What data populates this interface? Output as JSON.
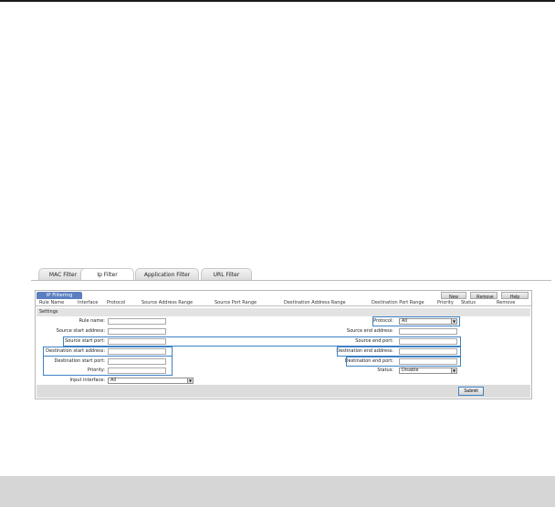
{
  "tabs": [
    {
      "label": "MAC Filter",
      "active": false
    },
    {
      "label": "Ip Filter",
      "active": true
    },
    {
      "label": "Application Filter",
      "active": false
    },
    {
      "label": "URL Filter",
      "active": false
    }
  ],
  "panel": {
    "title": "IP Filtering",
    "buttons": {
      "new": "New",
      "remove": "Remove",
      "help": "Help"
    },
    "columns": [
      "Rule Name",
      "Interface",
      "Protocol",
      "Source Address Range",
      "Source Port Range",
      "Destination Address Range",
      "Destination Port Range",
      "Priority",
      "Status",
      "Remove"
    ],
    "settings_title": "Settings"
  },
  "form": {
    "rule_name": {
      "label": "Rule name:",
      "value": ""
    },
    "source_start_address": {
      "label": "Source start address:",
      "value": ""
    },
    "source_start_port": {
      "label": "Source start port:",
      "value": ""
    },
    "destination_start_address": {
      "label": "Destination start address:",
      "value": ""
    },
    "destination_start_port": {
      "label": "Destination start port:",
      "value": ""
    },
    "priority": {
      "label": "Priority:",
      "value": ""
    },
    "input_interface": {
      "label": "Input interface:",
      "value": "All"
    },
    "protocol": {
      "label": "Protocol:",
      "value": "All"
    },
    "source_end_address": {
      "label": "Source end address:",
      "value": ""
    },
    "source_end_port": {
      "label": "Source end port:",
      "value": ""
    },
    "destination_end_address": {
      "label": "Destination end address:",
      "value": ""
    },
    "destination_end_port": {
      "label": "Destination end port:",
      "value": ""
    },
    "status": {
      "label": "Status:",
      "value": "Disable"
    }
  },
  "submit_label": "Submit",
  "icons": {
    "dropdown": "chevron-down-icon"
  },
  "colors": {
    "tab_title": "#5a7fc0",
    "highlight": "#3d82c4"
  }
}
